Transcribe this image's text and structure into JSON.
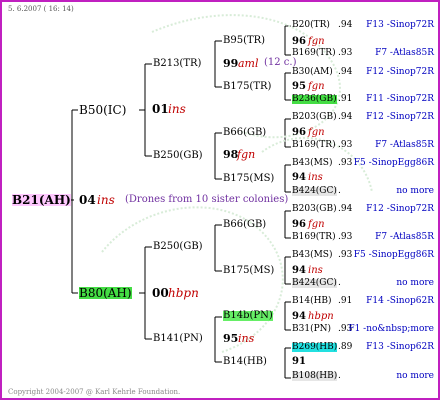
{
  "header": {
    "date": "5.  6.2007 ( 16: 14)"
  },
  "footer": {
    "copyright": "Copyright 2004-2007 @ Karl Kehrle Foundation."
  },
  "root": {
    "name": "B21(AH)",
    "year": "04",
    "note": "ins",
    "drones": "(Drones from 10 sister colonies)"
  },
  "gen1": {
    "top": {
      "name": "B50(IC)",
      "year": "01",
      "note": "ins"
    },
    "bottom": {
      "name": "B80(AH)",
      "year": "00",
      "note": "hbpn"
    }
  },
  "gen2": {
    "b213": {
      "name": "B213(TR)"
    },
    "b250a": {
      "name": "B250(GB)"
    },
    "b250b": {
      "name": "B250(GB)",
      "year": "98",
      "note": "fgn"
    },
    "b141": {
      "name": "B141(PN)"
    }
  },
  "gen3": {
    "b95": {
      "name": "B95(TR)",
      "year": "99",
      "note": "aml",
      "extra": "(12 c.)"
    },
    "b175a": {
      "name": "B175(TR)"
    },
    "b66a": {
      "name": "B66(GB)",
      "year": "98",
      "note": "fgn"
    },
    "b175b": {
      "name": "B175(MS)",
      "year": "94",
      "note": "ins"
    },
    "b66b": {
      "name": "B66(GB)",
      "year": "98",
      "note": "fgn"
    },
    "b175c": {
      "name": "B175(MS)",
      "year": "94",
      "note": "ins"
    },
    "b14b": {
      "name": "B14b(PN)",
      "year": "95",
      "note": "ins"
    },
    "b14": {
      "name": "B14(HB)",
      "year": "91"
    }
  },
  "gen4": [
    {
      "name": "B20(TR)",
      "score": ".94",
      "link": "F13 -Sinop72R"
    },
    {
      "year": "96",
      "note": "fgn"
    },
    {
      "name": "B169(TR)",
      "score": ".93",
      "link": "F7 -Atlas85R"
    },
    {
      "name": "B30(AM)",
      "score": ".94",
      "link": "F12 -Sinop72R"
    },
    {
      "year": "95",
      "note": "fgn"
    },
    {
      "name": "B236(GB)",
      "score": ".91",
      "link": "F11 -Sinop72R"
    },
    {
      "name": "B203(GB)",
      "score": ".94",
      "link": "F12 -Sinop72R"
    },
    {
      "year": "96",
      "note": "fgn"
    },
    {
      "name": "B169(TR)",
      "score": ".93",
      "link": "F7 -Atlas85R"
    },
    {
      "name": "B43(MS)",
      "score": ".93",
      "link": "F5 -SinopEgg86R"
    },
    {
      "year": "94",
      "note": "ins"
    },
    {
      "name": "B424(GC)",
      "score": ".",
      "link": "no more"
    },
    {
      "name": "B203(GB)",
      "score": ".94",
      "link": "F12 -Sinop72R"
    },
    {
      "year": "96",
      "note": "fgn"
    },
    {
      "name": "B169(TR)",
      "score": ".93",
      "link": "F7 -Atlas85R"
    },
    {
      "name": "B43(MS)",
      "score": ".93",
      "link": "F5 -SinopEgg86R"
    },
    {
      "year": "94",
      "note": "ins"
    },
    {
      "name": "B424(GC)",
      "score": ".",
      "link": "no more"
    },
    {
      "name": "B14(HB)",
      "score": ".91",
      "link": "F14 -Sinop62R"
    },
    {
      "year": "94",
      "note": "hbpn"
    },
    {
      "name": "B31(PN)",
      "score": ".93",
      "link": "F1 -no&nbsp;more"
    },
    {
      "name": "B269(HB)",
      "score": ".89",
      "link": "F13 -Sinop62R"
    },
    {
      "year": "91"
    },
    {
      "name": "B108(HB)",
      "score": ".",
      "link": "no more"
    }
  ]
}
